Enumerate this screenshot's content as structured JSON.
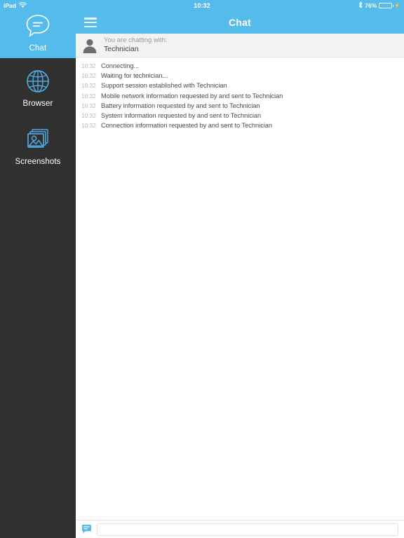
{
  "status_bar": {
    "device_label": "iPad",
    "wifi_icon": "wifi-icon",
    "time": "10:32",
    "bluetooth_icon": "bluetooth-icon",
    "battery_percent": "76%",
    "battery_level": 76,
    "battery_icon": "battery-icon",
    "charging_icon": "plug-icon"
  },
  "theme": {
    "accent_blue": "#55bbea",
    "sidebar_dark": "#303030",
    "header_gray": "#f2f2f2",
    "text_dark": "#4a4a4a",
    "text_muted": "#b6b6b6"
  },
  "sidebar": {
    "items": [
      {
        "label": "Chat",
        "icon": "chat-bubble-icon",
        "active": true
      },
      {
        "label": "Browser",
        "icon": "globe-icon",
        "active": false
      },
      {
        "label": "Screenshots",
        "icon": "photos-stack-icon",
        "active": false
      }
    ]
  },
  "navbar": {
    "menu_icon": "hamburger-menu-icon",
    "title": "Chat"
  },
  "chat_header": {
    "avatar_icon": "person-avatar-icon",
    "subtitle": "You are chatting with:",
    "name": "Technician"
  },
  "messages": [
    {
      "time": "10:32",
      "text": "Connecting..."
    },
    {
      "time": "10:32",
      "text": "Waiting for technician..."
    },
    {
      "time": "10:32",
      "text": "Support session established with Technician"
    },
    {
      "time": "10:32",
      "text": "Mobile network information requested by and sent to Technician"
    },
    {
      "time": "10:32",
      "text": "Battery information requested by and sent to Technician"
    },
    {
      "time": "10:32",
      "text": "System information requested by and sent to Technician"
    },
    {
      "time": "10:32",
      "text": "Connection information requested by and sent to Technician"
    }
  ],
  "composer": {
    "icon": "chat-bubble-small-icon",
    "value": "",
    "placeholder": ""
  }
}
